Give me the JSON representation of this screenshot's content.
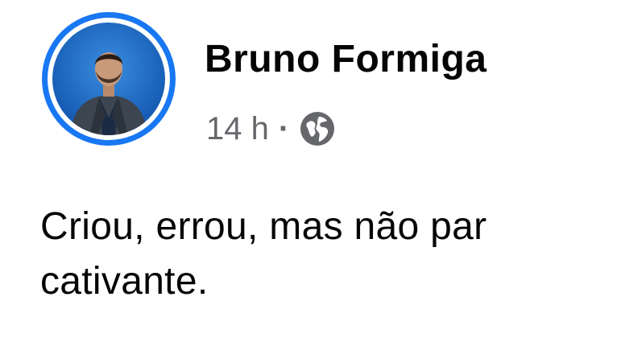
{
  "post": {
    "author_name": "Bruno Formiga",
    "timestamp": "14 h",
    "separator": "·",
    "privacy_icon": "globe-icon",
    "message_lines": [
      "Criou, errou, mas não par",
      "cativante."
    ]
  },
  "colors": {
    "avatar_ring": "#1877f2",
    "author_text": "#050505",
    "meta_text": "#65676b"
  }
}
